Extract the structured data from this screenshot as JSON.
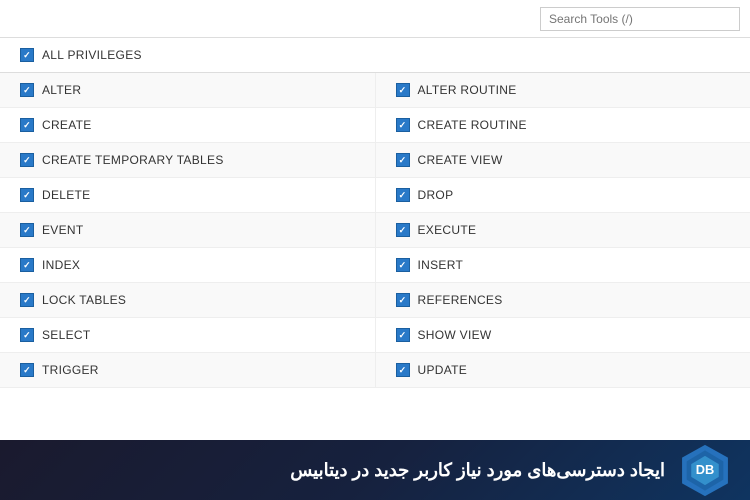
{
  "topbar": {
    "search_placeholder": "Search Tools (/)"
  },
  "privileges": {
    "all_privileges_label": "ALL PRIVILEGES",
    "rows": [
      {
        "left": "ALTER",
        "right": "ALTER ROUTINE"
      },
      {
        "left": "CREATE",
        "right": "CREATE ROUTINE"
      },
      {
        "left": "CREATE TEMPORARY TABLES",
        "right": "CREATE VIEW"
      },
      {
        "left": "DELETE",
        "right": "DROP"
      },
      {
        "left": "EVENT",
        "right": "EXECUTE"
      },
      {
        "left": "INDEX",
        "right": "INSERT"
      },
      {
        "left": "LOCK TABLES",
        "right": "REFERENCES"
      },
      {
        "left": "SELECT",
        "right": "SHOW VIEW"
      },
      {
        "left": "TRIGGER",
        "right": "UPDATE"
      }
    ]
  },
  "banner": {
    "text": "ایجاد دسترسی‌های مورد نیاز کاربر جدید در دیتابیس"
  }
}
